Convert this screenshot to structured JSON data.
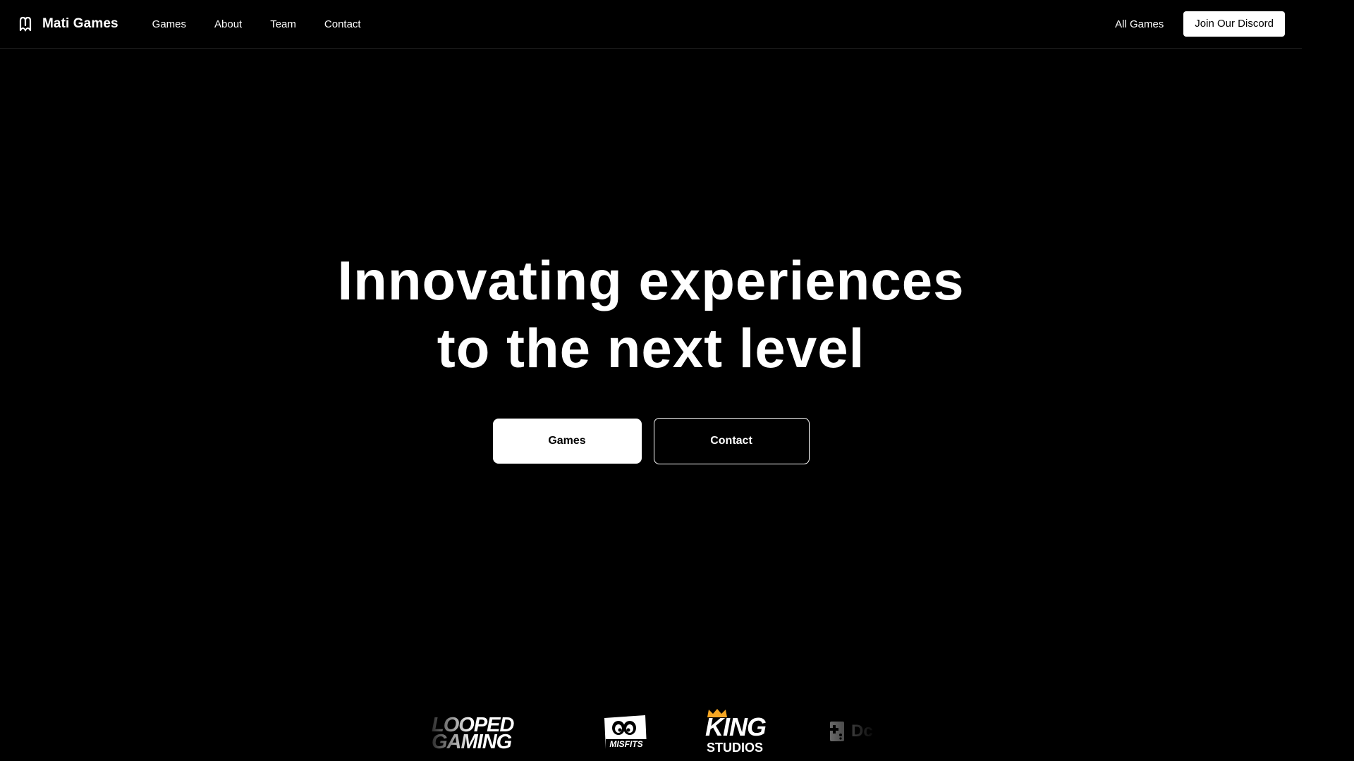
{
  "navbar": {
    "brand_name": "Mati Games",
    "brand_icon": "mati-logo-icon",
    "links": [
      {
        "label": "Games"
      },
      {
        "label": "About"
      },
      {
        "label": "Team"
      },
      {
        "label": "Contact"
      }
    ],
    "all_games_label": "All Games",
    "discord_label": "Join Our Discord"
  },
  "hero": {
    "title_line_1": "Innovating experiences",
    "title_line_2": "to the next level",
    "primary_button_label": "Games",
    "secondary_button_label": "Contact"
  },
  "partner_logos": {
    "looped_line_1": "LOOPED",
    "looped_line_2": "GAMING",
    "misfits_text": "MISFITS",
    "king_word": "KING",
    "studios_word": "STUDIOS",
    "dc_text": "Dc"
  },
  "colors": {
    "background": "#000000",
    "foreground": "#ffffff",
    "crown_accent": "#f5a623"
  }
}
